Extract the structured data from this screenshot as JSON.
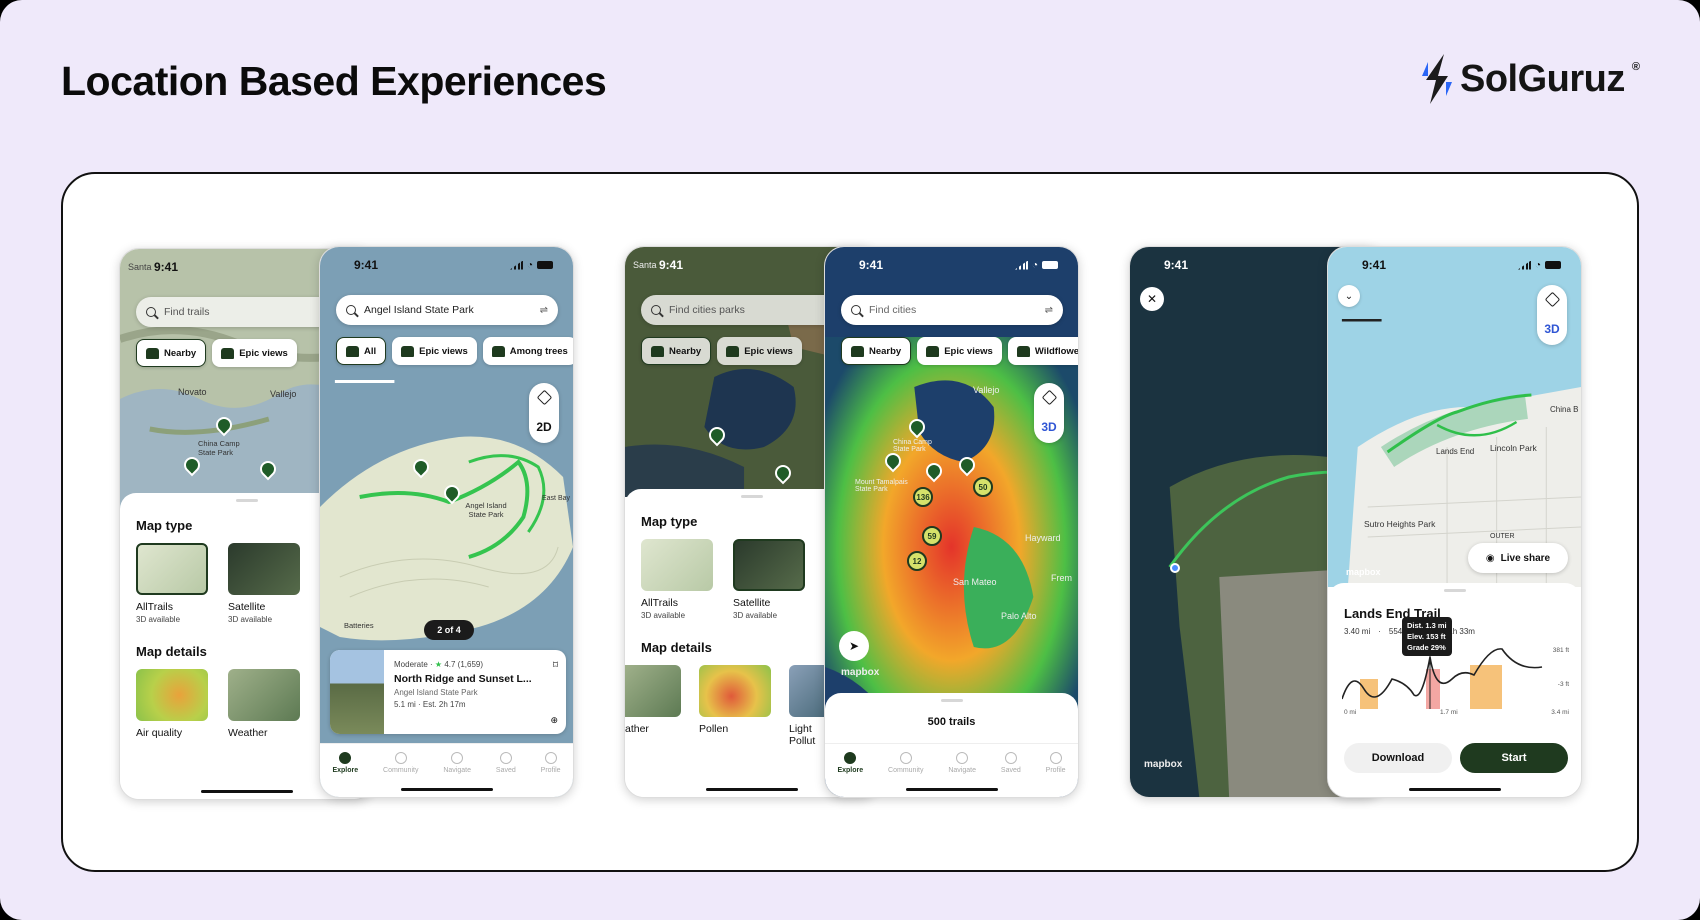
{
  "header": {
    "title": "Location Based Experiences",
    "brand": "SolGuruz",
    "brand_mark": "®"
  },
  "colors": {
    "background": "#efe9fa",
    "primary_dark": "#1f3a1f",
    "trail_green": "#2fbf4a"
  },
  "group1": {
    "back": {
      "time": "9:41",
      "corner_label": "Santa",
      "search_placeholder": "Find trails",
      "chips": [
        "Nearby",
        "Epic views"
      ],
      "places": [
        "Novato",
        "Vallejo",
        "China Camp State Park"
      ],
      "map_type_title": "Map type",
      "map_types": [
        {
          "label": "AllTrails",
          "sub": "3D available"
        },
        {
          "label": "Satellite",
          "sub": "3D available"
        }
      ],
      "map_details_title": "Map details",
      "map_details": [
        "Air quality",
        "Weather"
      ]
    },
    "front": {
      "time": "9:41",
      "search_value": "Angel Island State Park",
      "chips": [
        "All",
        "Epic views",
        "Among trees"
      ],
      "mode_button": "2D",
      "places": [
        "Angel Island State Park",
        "East Bay",
        "Batteries"
      ],
      "pager": "2 of 4",
      "trail_card": {
        "difficulty": "Moderate",
        "rating": "4.7",
        "reviews": "(1,659)",
        "name": "North Ridge and Sunset L...",
        "park": "Angel Island State Park",
        "meta": "5.1 mi · Est. 2h 17m"
      },
      "tabs": [
        "Explore",
        "Community",
        "Navigate",
        "Saved",
        "Profile"
      ]
    }
  },
  "group2": {
    "back": {
      "time": "9:41",
      "corner_label": "Santa",
      "search_placeholder": "Find cities parks",
      "chips": [
        "Nearby",
        "Epic views"
      ],
      "map_type_title": "Map type",
      "map_types": [
        {
          "label": "AllTrails",
          "sub": "3D available"
        },
        {
          "label": "Satellite",
          "sub": "3D available"
        }
      ],
      "map_details_title": "Map details",
      "map_details": [
        "ather",
        "Pollen",
        "Light Pollut"
      ]
    },
    "front": {
      "time": "9:41",
      "search_placeholder": "Find cities",
      "chips": [
        "Nearby",
        "Epic views",
        "Wildflowers"
      ],
      "mode_button": "3D",
      "places": [
        "Vallejo",
        "China Camp State Park",
        "Mount Tamalpais State Park",
        "Hayward",
        "San Mateo",
        "Palo Alto",
        "Frem"
      ],
      "trail_counts": [
        "136",
        "50",
        "59",
        "12"
      ],
      "attribution": "mapbox",
      "result_count": "500 trails",
      "tabs": [
        "Explore",
        "Community",
        "Navigate",
        "Saved",
        "Profile"
      ]
    }
  },
  "group3": {
    "back": {
      "time": "9:41",
      "attribution": "mapbox"
    },
    "front": {
      "time": "9:41",
      "mode_button": "3D",
      "places": [
        "China B",
        "Lincoln Park",
        "Lands End",
        "Sutro Heights Park",
        "OUTER"
      ],
      "live_share": "Live share",
      "attribution": "mapbox",
      "trail_title": "Lands End Trail",
      "trail_stats": [
        "3.40 mi",
        "554",
        "1h 33m"
      ],
      "tooltip": [
        "Dist. 1.3 mi",
        "Elev. 153 ft",
        "Grade 29%"
      ],
      "elev_axis": [
        "381 ft",
        "-3 ft"
      ],
      "dist_axis": [
        "0 mi",
        "1.7 mi",
        "3.4 mi"
      ],
      "download_label": "Download",
      "start_label": "Start"
    }
  }
}
